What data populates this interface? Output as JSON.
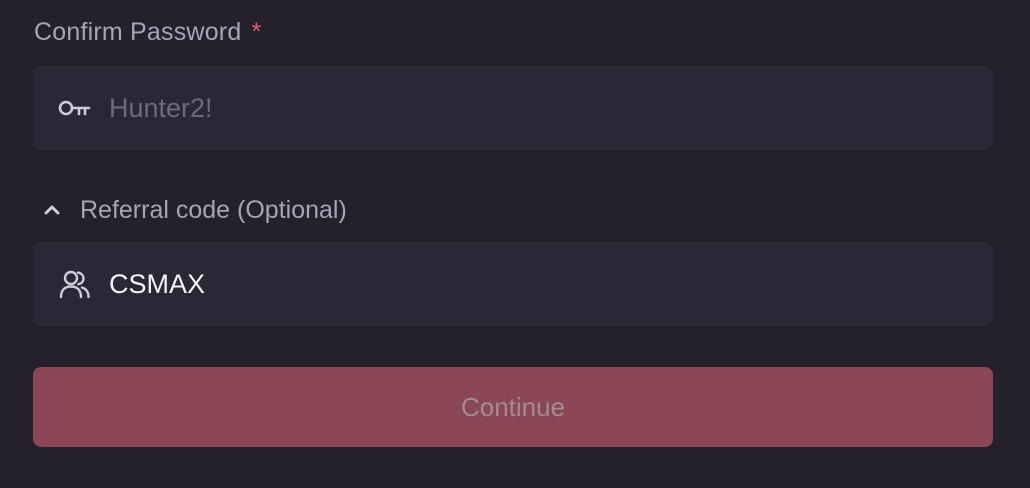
{
  "confirm_password": {
    "label": "Confirm Password",
    "required_marker": "*",
    "icon": "key-icon",
    "placeholder": "Hunter2!",
    "value": ""
  },
  "referral": {
    "toggle_label": "Referral code (Optional)",
    "toggle_icon": "chevron-up-icon",
    "expanded": true,
    "icon": "users-icon",
    "value": "CSMAX"
  },
  "continue_button": {
    "label": "Continue",
    "disabled": true
  },
  "colors": {
    "background": "#24212d",
    "field_background": "#2a2736",
    "label_text": "#a8a3b6",
    "required_accent": "#e45a73",
    "button_background": "#8b4756",
    "button_text": "#a18c94"
  }
}
